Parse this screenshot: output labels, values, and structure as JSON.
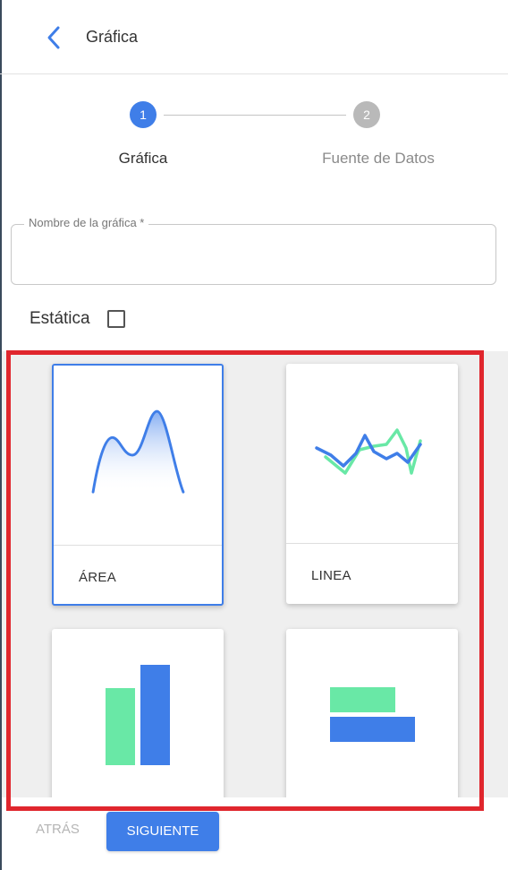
{
  "header": {
    "title": "Gráfica",
    "back_icon": "chevron-left-icon"
  },
  "stepper": {
    "steps": [
      {
        "number": "1",
        "label": "Gráfica",
        "active": true
      },
      {
        "number": "2",
        "label": "Fuente de Datos",
        "active": false
      }
    ]
  },
  "form": {
    "name_field": {
      "label": "Nombre de la gráfica *",
      "value": ""
    },
    "static_checkbox": {
      "label": "Estática",
      "checked": false
    }
  },
  "chart_types": [
    {
      "label": "ÁREA",
      "icon": "area-chart-icon",
      "selected": true
    },
    {
      "label": "LINEA",
      "icon": "line-chart-icon",
      "selected": false
    },
    {
      "label": "",
      "icon": "bar-chart-icon",
      "selected": false
    },
    {
      "label": "",
      "icon": "horizontal-bar-chart-icon",
      "selected": false
    }
  ],
  "footer": {
    "back_label": "ATRÁS",
    "next_label": "SIGUIENTE"
  },
  "colors": {
    "primary": "#3f7ee8",
    "inactive_step": "#b9b9b9",
    "chart_green": "#69e8a6",
    "chart_blue": "#3f7ee8",
    "highlight_frame": "#e0262d"
  }
}
